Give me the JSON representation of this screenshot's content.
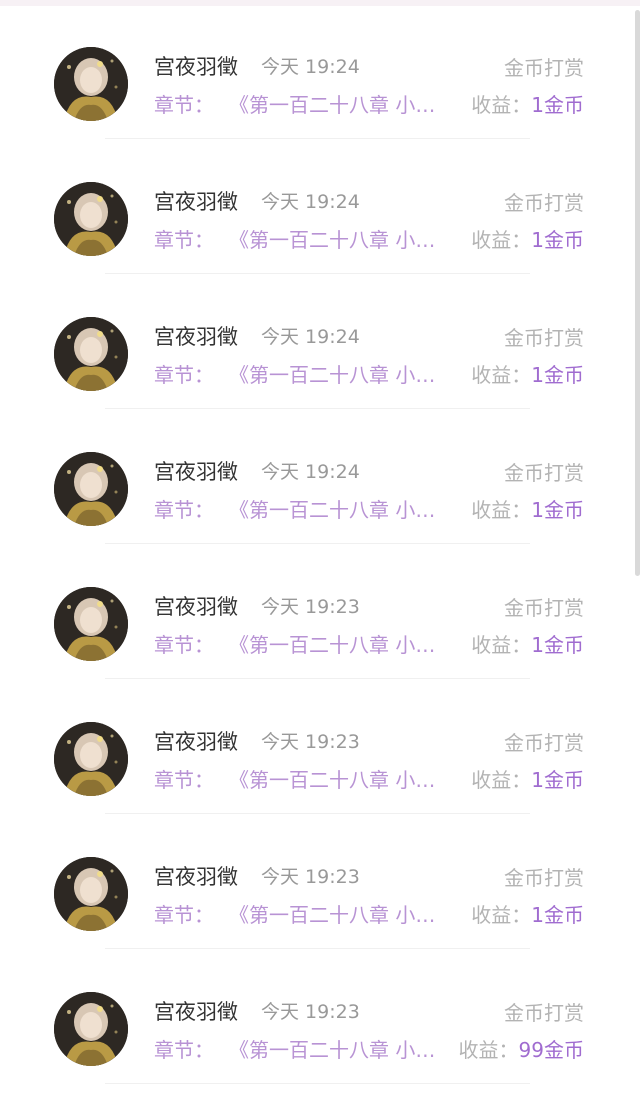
{
  "items": [
    {
      "name": "宫夜羽徵",
      "time": "今天 19:24",
      "kind": "金币打赏",
      "chapter_label": "章节：",
      "chapter_title": "《第一百二十八章 小婉的回归》",
      "income_label": "收益：",
      "income_value": "1金币"
    },
    {
      "name": "宫夜羽徵",
      "time": "今天 19:24",
      "kind": "金币打赏",
      "chapter_label": "章节：",
      "chapter_title": "《第一百二十八章 小婉的回归》",
      "income_label": "收益：",
      "income_value": "1金币"
    },
    {
      "name": "宫夜羽徵",
      "time": "今天 19:24",
      "kind": "金币打赏",
      "chapter_label": "章节：",
      "chapter_title": "《第一百二十八章 小婉的回归》",
      "income_label": "收益：",
      "income_value": "1金币"
    },
    {
      "name": "宫夜羽徵",
      "time": "今天 19:24",
      "kind": "金币打赏",
      "chapter_label": "章节：",
      "chapter_title": "《第一百二十八章 小婉的回归》",
      "income_label": "收益：",
      "income_value": "1金币"
    },
    {
      "name": "宫夜羽徵",
      "time": "今天 19:23",
      "kind": "金币打赏",
      "chapter_label": "章节：",
      "chapter_title": "《第一百二十八章 小婉的回归》",
      "income_label": "收益：",
      "income_value": "1金币"
    },
    {
      "name": "宫夜羽徵",
      "time": "今天 19:23",
      "kind": "金币打赏",
      "chapter_label": "章节：",
      "chapter_title": "《第一百二十八章 小婉的回归》",
      "income_label": "收益：",
      "income_value": "1金币"
    },
    {
      "name": "宫夜羽徵",
      "time": "今天 19:23",
      "kind": "金币打赏",
      "chapter_label": "章节：",
      "chapter_title": "《第一百二十八章 小婉的回归》",
      "income_label": "收益：",
      "income_value": "1金币"
    },
    {
      "name": "宫夜羽徵",
      "time": "今天 19:23",
      "kind": "金币打赏",
      "chapter_label": "章节：",
      "chapter_title": "《第一百二十八章 小婉的回归》",
      "income_label": "收益：",
      "income_value": "99金币"
    }
  ],
  "colors": {
    "accent": "#a06cd0",
    "chapter": "#b893d4",
    "muted": "#b3b3b3",
    "text": "#333333"
  },
  "avatar_icon": "user-avatar-portrait"
}
